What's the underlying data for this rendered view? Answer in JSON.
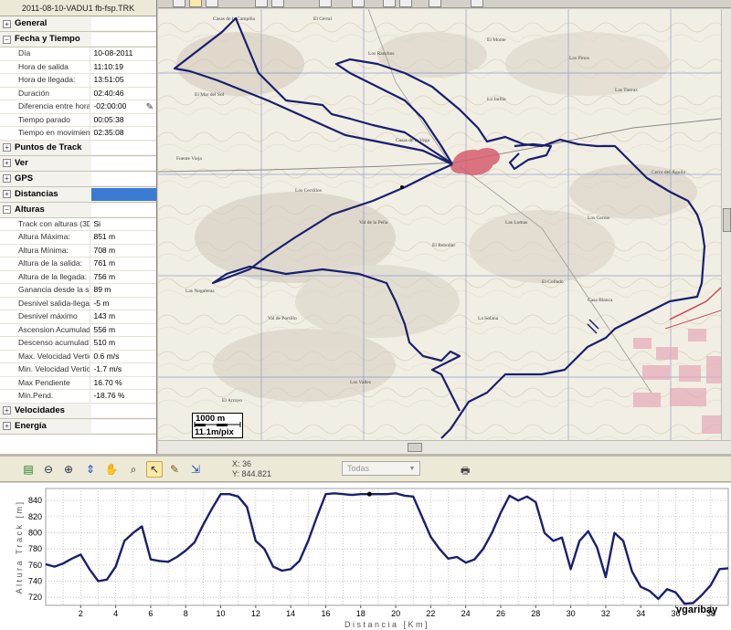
{
  "panel": {
    "title": "2011-08-10-VADU1 fb-fsp.TRK",
    "sections": [
      {
        "label": "General",
        "expanded": false
      },
      {
        "label": "Fecha y Tiempo",
        "expanded": true,
        "rows": [
          {
            "key": "Día",
            "value": "10-08-2011"
          },
          {
            "key": "Hora de salida",
            "value": "11:10:19"
          },
          {
            "key": "Hora de llegada:",
            "value": "13:51:05"
          },
          {
            "key": "Duración",
            "value": "02:40:46"
          },
          {
            "key": "Diferencia entre hora",
            "value": "-02:00:00",
            "editable": true
          },
          {
            "key": "Tiempo parado",
            "value": "00:05:38"
          },
          {
            "key": "Tiempo en movimient",
            "value": "02:35:08"
          }
        ]
      },
      {
        "label": "Puntos de Track",
        "expanded": false
      },
      {
        "label": "Ver",
        "expanded": false
      },
      {
        "label": "GPS",
        "expanded": false
      },
      {
        "label": "Distancias",
        "expanded": false,
        "selected": true
      },
      {
        "label": "Alturas",
        "expanded": true,
        "rows": [
          {
            "key": "Track con alturas (3D",
            "value": "Si"
          },
          {
            "key": "Altura Máxima:",
            "value": "851 m"
          },
          {
            "key": "Altura Mínima:",
            "value": "708 m"
          },
          {
            "key": "Altura de la salida:",
            "value": "761 m"
          },
          {
            "key": "Altura de la llegada:",
            "value": "756 m"
          },
          {
            "key": "Ganancia desde la sal",
            "value": "89 m"
          },
          {
            "key": "Desnivel salida-llegad",
            "value": "-5 m"
          },
          {
            "key": "Desnivel máximo",
            "value": "143 m"
          },
          {
            "key": "Ascension Acumulad",
            "value": "556 m"
          },
          {
            "key": "Descenso acumulad",
            "value": "510 m"
          },
          {
            "key": "Max. Velocidad Vertic",
            "value": "0.6 m/s"
          },
          {
            "key": "Min. Velocidad Vertic",
            "value": "-1.7 m/s"
          },
          {
            "key": "Max Pendiente",
            "value": "16.70 %"
          },
          {
            "key": "Min.Pend.",
            "value": "-18.76 %"
          }
        ]
      },
      {
        "label": "Velocidades",
        "expanded": false
      },
      {
        "label": "Energía",
        "expanded": false
      }
    ]
  },
  "map": {
    "scale_distance": "1000 m",
    "scale_resolution": "11.1m/pix"
  },
  "profile": {
    "coord_x": "X:  36",
    "coord_y": "Y:  844.821",
    "filter_select": "Todas",
    "icons": [
      "save-icon",
      "zoom-out-icon",
      "zoom-in-icon",
      "fit-icon",
      "pan-hand-icon",
      "zoom-window-icon",
      "select-icon",
      "pencil-icon",
      "export-icon"
    ]
  },
  "chart_data": {
    "type": "line",
    "xlabel": "Distancia [Km]",
    "ylabel": "Altura Track [m]",
    "xlim": [
      0,
      39
    ],
    "ylim": [
      710,
      855
    ],
    "xticks": [
      2,
      4,
      6,
      8,
      10,
      12,
      14,
      16,
      18,
      20,
      22,
      24,
      26,
      28,
      30,
      32,
      34,
      36,
      38
    ],
    "yticks": [
      720,
      740,
      760,
      780,
      800,
      820,
      840
    ],
    "grid": true,
    "series": [
      {
        "x": [
          0,
          0.5,
          1,
          1.5,
          2,
          2.5,
          3,
          3.5,
          4,
          4.5,
          5,
          5.5,
          6,
          6.5,
          7,
          7.5,
          8,
          8.5,
          9,
          9.5,
          10,
          10.5,
          11,
          11.5,
          12,
          12.5,
          13,
          13.5,
          14,
          14.5,
          15,
          15.5,
          16,
          16.5,
          17,
          17.5,
          18,
          18.5,
          19,
          19.5,
          20,
          20.5,
          21,
          21.5,
          22,
          22.5,
          23,
          23.5,
          24,
          24.5,
          25,
          25.5,
          26,
          26.5,
          27,
          27.5,
          28,
          28.5,
          29,
          29.5,
          30,
          30.5,
          31,
          31.5,
          32,
          32.5,
          33,
          33.5,
          34,
          34.5,
          35,
          35.5,
          36,
          36.5,
          37,
          37.5,
          38,
          38.5,
          39
        ],
        "y": [
          761,
          758,
          762,
          768,
          773,
          755,
          740,
          742,
          758,
          790,
          800,
          808,
          767,
          765,
          764,
          770,
          778,
          788,
          810,
          830,
          848,
          848,
          845,
          832,
          790,
          780,
          758,
          753,
          755,
          765,
          790,
          820,
          848,
          849,
          848,
          847,
          848,
          848,
          848,
          848,
          849,
          846,
          845,
          820,
          795,
          780,
          768,
          770,
          763,
          767,
          780,
          800,
          825,
          846,
          840,
          845,
          838,
          800,
          790,
          794,
          755,
          790,
          802,
          782,
          745,
          800,
          790,
          752,
          733,
          728,
          718,
          730,
          726,
          712,
          713,
          723,
          735,
          755,
          756
        ]
      }
    ]
  },
  "watermark": "vgaribay",
  "colors": {
    "track": "#1a1f6e",
    "map_bg": "#f1eee4",
    "selection": "#3a7bd5"
  }
}
